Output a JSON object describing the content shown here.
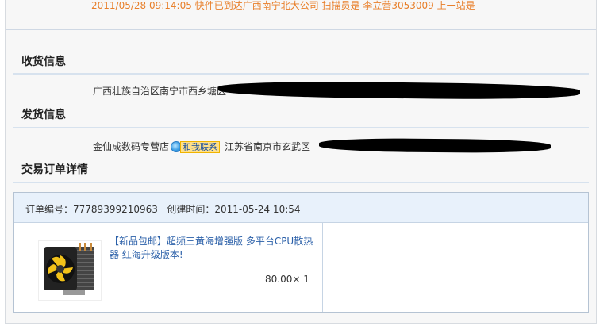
{
  "logistics": {
    "latest": "2011/05/28 09:14:05 快件已到达广西南宁北大公司 扫描员是 李立营3053009 上一站是"
  },
  "receiver": {
    "title": "收货信息",
    "address": "广西壮族自治区南宁市西乡塘区"
  },
  "sender": {
    "title": "发货信息",
    "shop": "金仙成数码专营店",
    "contact_label": "和我联系",
    "address": "江苏省南京市玄武区"
  },
  "order": {
    "title": "交易订单详情",
    "number_label": "订单编号：",
    "number": "77789399210963",
    "created_label": "创建时间：",
    "created": "2011-05-24 10:54",
    "item": {
      "title": "【新品包邮】超频三黄海增强版 多平台CPU散热器 红海升级版本!",
      "price": "80.00",
      "quantity_text": "× 1"
    }
  },
  "colors": {
    "logistics_text": "#e87f2a",
    "link": "#2a5fa8",
    "header_bg": "#e8f1fb"
  },
  "icons": {
    "contact": "wangwang-icon",
    "product": "cpu-cooler-thumbnail"
  }
}
